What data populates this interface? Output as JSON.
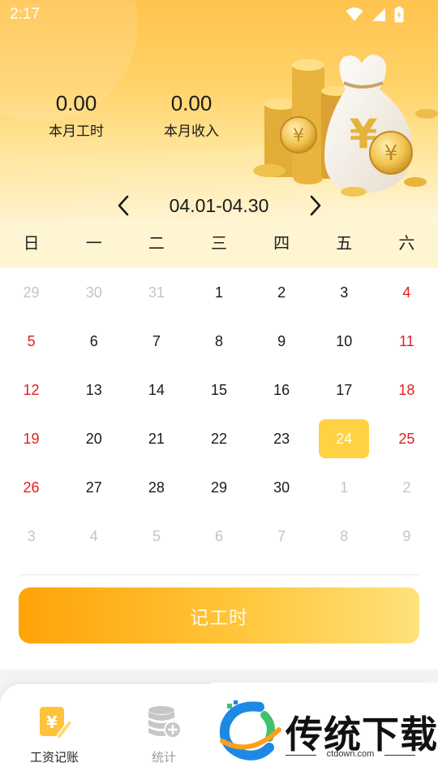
{
  "status_bar": {
    "time": "2:17"
  },
  "summary": {
    "hours": {
      "value": "0.00",
      "label": "本月工时"
    },
    "income": {
      "value": "0.00",
      "label": "本月收入"
    }
  },
  "month_nav": {
    "range": "04.01-04.30"
  },
  "weekdays": [
    "日",
    "一",
    "二",
    "三",
    "四",
    "五",
    "六"
  ],
  "calendar": [
    [
      {
        "d": "29",
        "t": "other"
      },
      {
        "d": "30",
        "t": "other"
      },
      {
        "d": "31",
        "t": "other"
      },
      {
        "d": "1",
        "t": "cur"
      },
      {
        "d": "2",
        "t": "cur"
      },
      {
        "d": "3",
        "t": "cur"
      },
      {
        "d": "4",
        "t": "weekend"
      }
    ],
    [
      {
        "d": "5",
        "t": "weekend"
      },
      {
        "d": "6",
        "t": "cur"
      },
      {
        "d": "7",
        "t": "cur"
      },
      {
        "d": "8",
        "t": "cur"
      },
      {
        "d": "9",
        "t": "cur"
      },
      {
        "d": "10",
        "t": "cur"
      },
      {
        "d": "11",
        "t": "weekend"
      }
    ],
    [
      {
        "d": "12",
        "t": "weekend"
      },
      {
        "d": "13",
        "t": "cur"
      },
      {
        "d": "14",
        "t": "cur"
      },
      {
        "d": "15",
        "t": "cur"
      },
      {
        "d": "16",
        "t": "cur"
      },
      {
        "d": "17",
        "t": "cur"
      },
      {
        "d": "18",
        "t": "weekend"
      }
    ],
    [
      {
        "d": "19",
        "t": "weekend"
      },
      {
        "d": "20",
        "t": "cur"
      },
      {
        "d": "21",
        "t": "cur"
      },
      {
        "d": "22",
        "t": "cur"
      },
      {
        "d": "23",
        "t": "cur"
      },
      {
        "d": "24",
        "t": "selected"
      },
      {
        "d": "25",
        "t": "weekend"
      }
    ],
    [
      {
        "d": "26",
        "t": "weekend"
      },
      {
        "d": "27",
        "t": "cur"
      },
      {
        "d": "28",
        "t": "cur"
      },
      {
        "d": "29",
        "t": "cur"
      },
      {
        "d": "30",
        "t": "cur"
      },
      {
        "d": "1",
        "t": "other"
      },
      {
        "d": "2",
        "t": "other"
      }
    ],
    [
      {
        "d": "3",
        "t": "other"
      },
      {
        "d": "4",
        "t": "other"
      },
      {
        "d": "5",
        "t": "other"
      },
      {
        "d": "6",
        "t": "other"
      },
      {
        "d": "7",
        "t": "other"
      },
      {
        "d": "8",
        "t": "other"
      },
      {
        "d": "9",
        "t": "other"
      }
    ]
  ],
  "record_button": {
    "label": "记工时"
  },
  "bottom_nav": [
    {
      "label": "工资记账",
      "icon": "wage-ledger-icon",
      "active": true
    },
    {
      "label": "统计",
      "icon": "statistics-icon",
      "active": false
    }
  ],
  "watermark": {
    "brand": "传统下载",
    "domain": "ctdown.com"
  },
  "colors": {
    "accent": "#ffc34d",
    "selected_day": "#ffd143",
    "weekend": "#e02020",
    "button_start": "#ffa308",
    "button_end": "#ffe27a"
  }
}
